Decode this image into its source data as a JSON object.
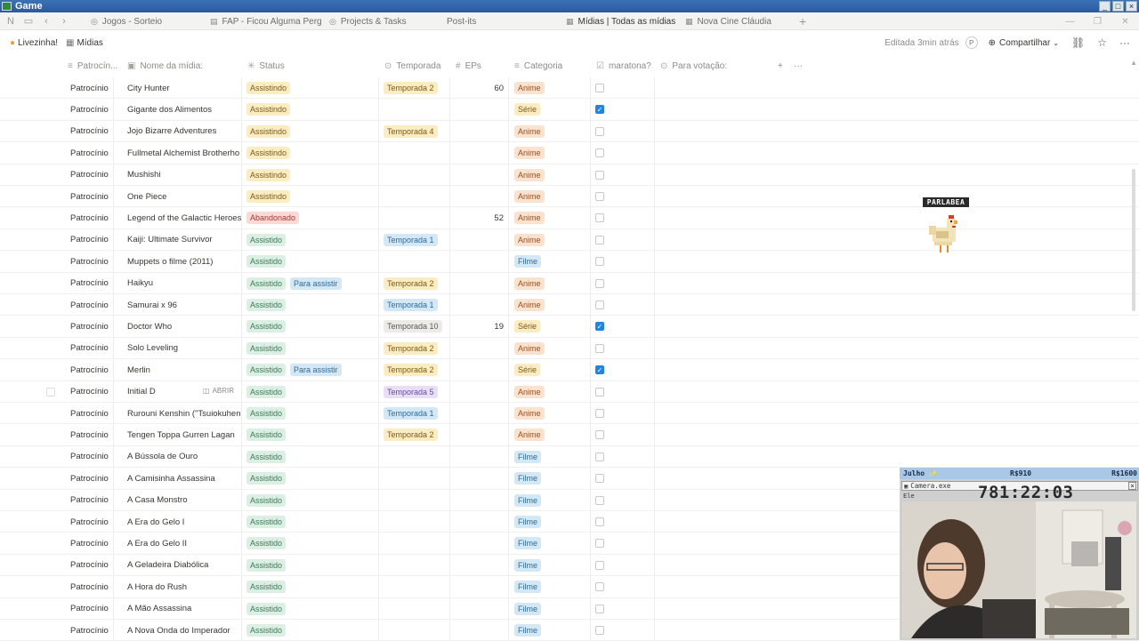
{
  "window": {
    "title": "Game"
  },
  "tabs": [
    {
      "label": "Jogos - Sorteio",
      "icon": "page-icon"
    },
    {
      "label": "FAP - Ficou Alguma Perg",
      "icon": "page-icon"
    },
    {
      "label": "Projects & Tasks",
      "icon": "target-icon"
    },
    {
      "label": "Post-its",
      "icon": ""
    },
    {
      "label": "Mídias | Todas as mídias",
      "icon": "table-icon"
    },
    {
      "label": "Nova Cine Cláudia",
      "icon": "table-icon"
    }
  ],
  "breadcrumb": {
    "workspace": "Livezinha!",
    "page": "Mídias"
  },
  "header": {
    "edited": "Editada 3min atrás",
    "avatar_letter": "P",
    "share_label": "Compartilhar"
  },
  "columns": {
    "patrocinio": "Patrocín...",
    "nome": "Nome da mídia:",
    "status": "Status",
    "temporada": "Temporada",
    "eps": "EPs",
    "categoria": "Categoria",
    "maratona": "maratona?",
    "votacao": "Para votação:"
  },
  "open_label": "ABRIR",
  "rows": [
    {
      "patrocinio": "Patrocínio",
      "nome": "City Hunter",
      "status": "Assistindo",
      "status2": "",
      "temporada": "Temporada 2",
      "eps": "60",
      "categoria": "Anime",
      "maratona": false
    },
    {
      "patrocinio": "Patrocínio",
      "nome": "Gigante dos Alimentos",
      "status": "Assistindo",
      "status2": "",
      "temporada": "",
      "eps": "",
      "categoria": "Série",
      "maratona": true
    },
    {
      "patrocinio": "Patrocínio",
      "nome": "Jojo Bizarre Adventures",
      "status": "Assistindo",
      "status2": "",
      "temporada": "Temporada 4",
      "eps": "",
      "categoria": "Anime",
      "maratona": false
    },
    {
      "patrocinio": "Patrocínio",
      "nome": "Fullmetal Alchemist Brotherho",
      "status": "Assistindo",
      "status2": "",
      "temporada": "",
      "eps": "",
      "categoria": "Anime",
      "maratona": false
    },
    {
      "patrocinio": "Patrocínio",
      "nome": "Mushishi",
      "status": "Assistindo",
      "status2": "",
      "temporada": "",
      "eps": "",
      "categoria": "Anime",
      "maratona": false
    },
    {
      "patrocinio": "Patrocínio",
      "nome": "One Piece",
      "status": "Assistindo",
      "status2": "",
      "temporada": "",
      "eps": "",
      "categoria": "Anime",
      "maratona": false
    },
    {
      "patrocinio": "Patrocínio",
      "nome": "Legend of the Galactic Heroes",
      "status": "Abandonado",
      "status2": "",
      "temporada": "",
      "eps": "52",
      "categoria": "Anime",
      "maratona": false
    },
    {
      "patrocinio": "Patrocínio",
      "nome": "Kaiji: Ultimate Survivor",
      "status": "Assistido",
      "status2": "",
      "temporada": "Temporada 1",
      "eps": "",
      "categoria": "Anime",
      "maratona": false
    },
    {
      "patrocinio": "Patrocínio",
      "nome": "Muppets o filme (2011)",
      "status": "Assistido",
      "status2": "",
      "temporada": "",
      "eps": "",
      "categoria": "Filme",
      "maratona": false
    },
    {
      "patrocinio": "Patrocínio",
      "nome": "Haikyu",
      "status": "Assistido",
      "status2": "Para assistir",
      "temporada": "Temporada 2",
      "eps": "",
      "categoria": "Anime",
      "maratona": false
    },
    {
      "patrocinio": "Patrocínio",
      "nome": "Samurai x 96",
      "status": "Assistido",
      "status2": "",
      "temporada": "Temporada 1",
      "eps": "",
      "categoria": "Anime",
      "maratona": false
    },
    {
      "patrocinio": "Patrocínio",
      "nome": "Doctor Who",
      "status": "Assistido",
      "status2": "",
      "temporada": "Temporada 10",
      "eps": "19",
      "categoria": "Série",
      "maratona": true
    },
    {
      "patrocinio": "Patrocínio",
      "nome": "Solo Leveling",
      "status": "Assistido",
      "status2": "",
      "temporada": "Temporada 2",
      "eps": "",
      "categoria": "Anime",
      "maratona": false
    },
    {
      "patrocinio": "Patrocínio",
      "nome": "Merlin",
      "status": "Assistido",
      "status2": "Para assistir",
      "temporada": "Temporada 2",
      "eps": "",
      "categoria": "Série",
      "maratona": true
    },
    {
      "patrocinio": "Patrocínio",
      "nome": "Initial D",
      "status": "Assistido",
      "status2": "",
      "temporada": "Temporada 5",
      "eps": "",
      "categoria": "Anime",
      "maratona": false,
      "hover": true
    },
    {
      "patrocinio": "Patrocínio",
      "nome": "Rurouni Kenshin (\"Tsuiokuhen",
      "status": "Assistido",
      "status2": "",
      "temporada": "Temporada 1",
      "eps": "",
      "categoria": "Anime",
      "maratona": false
    },
    {
      "patrocinio": "Patrocínio",
      "nome": "Tengen Toppa Gurren Lagan",
      "status": "Assistido",
      "status2": "",
      "temporada": "Temporada 2",
      "eps": "",
      "categoria": "Anime",
      "maratona": false
    },
    {
      "patrocinio": "Patrocínio",
      "nome": "A Bússola de Ouro",
      "status": "Assistido",
      "status2": "",
      "temporada": "",
      "eps": "",
      "categoria": "Filme",
      "maratona": false
    },
    {
      "patrocinio": "Patrocínio",
      "nome": "A Camisinha Assassina",
      "status": "Assistido",
      "status2": "",
      "temporada": "",
      "eps": "",
      "categoria": "Filme",
      "maratona": false
    },
    {
      "patrocinio": "Patrocínio",
      "nome": "A Casa Monstro",
      "status": "Assistido",
      "status2": "",
      "temporada": "",
      "eps": "",
      "categoria": "Filme",
      "maratona": false
    },
    {
      "patrocinio": "Patrocínio",
      "nome": "A Era do Gelo I",
      "status": "Assistido",
      "status2": "",
      "temporada": "",
      "eps": "",
      "categoria": "Filme",
      "maratona": false
    },
    {
      "patrocinio": "Patrocínio",
      "nome": "A Era do Gelo II",
      "status": "Assistido",
      "status2": "",
      "temporada": "",
      "eps": "",
      "categoria": "Filme",
      "maratona": false
    },
    {
      "patrocinio": "Patrocínio",
      "nome": "A Geladeira Diabólica",
      "status": "Assistido",
      "status2": "",
      "temporada": "",
      "eps": "",
      "categoria": "Filme",
      "maratona": false
    },
    {
      "patrocinio": "Patrocínio",
      "nome": "A Hora do Rush",
      "status": "Assistido",
      "status2": "",
      "temporada": "",
      "eps": "",
      "categoria": "Filme",
      "maratona": false
    },
    {
      "patrocinio": "Patrocínio",
      "nome": "A Mão Assassina",
      "status": "Assistido",
      "status2": "",
      "temporada": "",
      "eps": "",
      "categoria": "Filme",
      "maratona": false
    },
    {
      "patrocinio": "Patrocínio",
      "nome": "A Nova Onda do Imperador",
      "status": "Assistido",
      "status2": "",
      "temporada": "",
      "eps": "",
      "categoria": "Filme",
      "maratona": false
    }
  ],
  "overlay": {
    "month": "Julho ✨",
    "value1": "R$910",
    "value2": "R$1600",
    "window_title": "Camera.exe",
    "timer": "781:22:03",
    "small_text": "Ele"
  },
  "chicken_label": "PARLABEA",
  "colors": {
    "accent_blue": "#2383e2",
    "pill_yellow": "#fbecc2",
    "pill_green": "#dcefe4",
    "pill_red": "#fbd9d6",
    "pill_blue": "#d4e7f5",
    "pill_orange": "#fbe2cf",
    "pill_purple": "#e8def8"
  }
}
